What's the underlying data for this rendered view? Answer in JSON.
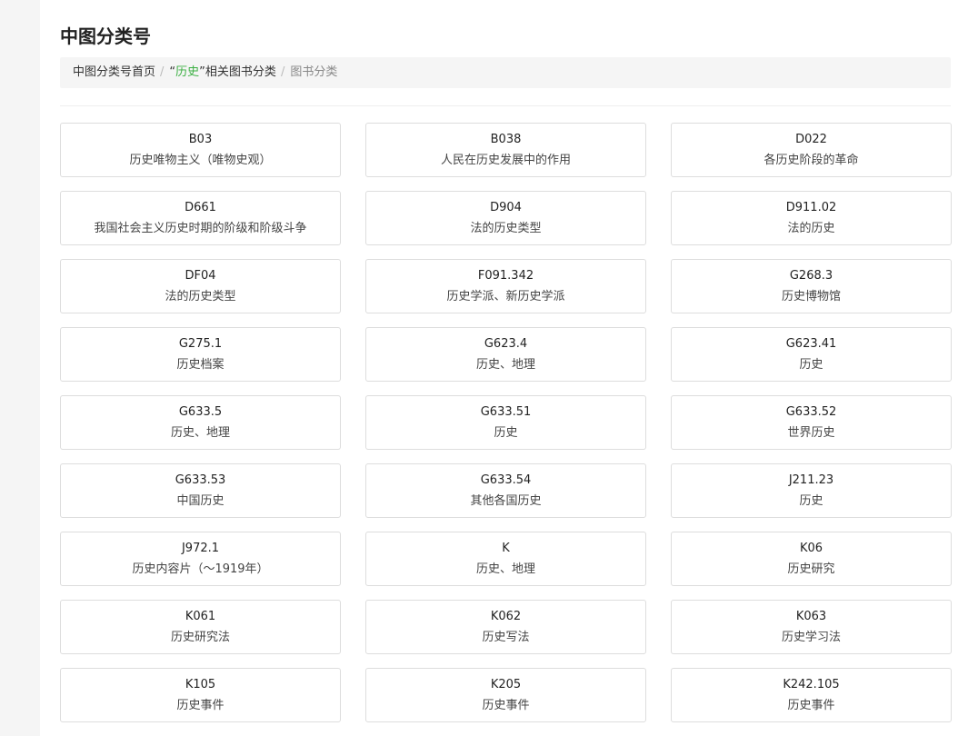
{
  "page_title": "中图分类号",
  "breadcrumb": {
    "home": "中图分类号首页",
    "sep": "/",
    "quote_open": "“",
    "keyword": "历史",
    "quote_close": "”",
    "suffix": "相关图书分类",
    "current": "图书分类"
  },
  "items": [
    {
      "code": "B03",
      "name": "历史唯物主义（唯物史观）"
    },
    {
      "code": "B038",
      "name": "人民在历史发展中的作用"
    },
    {
      "code": "D022",
      "name": "各历史阶段的革命"
    },
    {
      "code": "D661",
      "name": "我国社会主义历史时期的阶级和阶级斗争"
    },
    {
      "code": "D904",
      "name": "法的历史类型"
    },
    {
      "code": "D911.02",
      "name": "法的历史"
    },
    {
      "code": "DF04",
      "name": "法的历史类型"
    },
    {
      "code": "F091.342",
      "name": "历史学派、新历史学派"
    },
    {
      "code": "G268.3",
      "name": "历史博物馆"
    },
    {
      "code": "G275.1",
      "name": "历史档案"
    },
    {
      "code": "G623.4",
      "name": "历史、地理"
    },
    {
      "code": "G623.41",
      "name": "历史"
    },
    {
      "code": "G633.5",
      "name": "历史、地理"
    },
    {
      "code": "G633.51",
      "name": "历史"
    },
    {
      "code": "G633.52",
      "name": "世界历史"
    },
    {
      "code": "G633.53",
      "name": "中国历史"
    },
    {
      "code": "G633.54",
      "name": "其他各国历史"
    },
    {
      "code": "J211.23",
      "name": "历史"
    },
    {
      "code": "J972.1",
      "name": "历史内容片（～1919年）"
    },
    {
      "code": "K",
      "name": "历史、地理"
    },
    {
      "code": "K06",
      "name": "历史研究"
    },
    {
      "code": "K061",
      "name": "历史研究法"
    },
    {
      "code": "K062",
      "name": "历史写法"
    },
    {
      "code": "K063",
      "name": "历史学习法"
    },
    {
      "code": "K105",
      "name": "历史事件"
    },
    {
      "code": "K205",
      "name": "历史事件"
    },
    {
      "code": "K242.105",
      "name": "历史事件"
    }
  ]
}
